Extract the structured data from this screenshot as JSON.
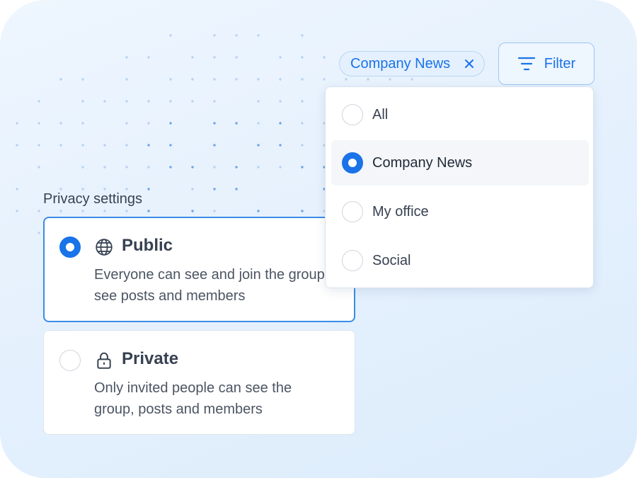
{
  "filter_bar": {
    "active_chip": {
      "label": "Company News",
      "remove_icon": "close-icon"
    },
    "filter_button": {
      "label": "Filter",
      "icon": "filter-lines-icon"
    }
  },
  "filter_dropdown": {
    "selected": "Company News",
    "items": [
      {
        "label": "All",
        "selected": false
      },
      {
        "label": "Company News",
        "selected": true
      },
      {
        "label": "My office",
        "selected": false
      },
      {
        "label": "Social",
        "selected": false
      }
    ]
  },
  "privacy": {
    "heading": "Privacy settings",
    "options": [
      {
        "title": "Public",
        "icon": "globe-icon",
        "description": "Everyone can see and join the group, see posts and members",
        "selected": true
      },
      {
        "title": "Private",
        "icon": "lock-icon",
        "description": "Only invited people can see the group, posts and members",
        "selected": false
      }
    ]
  },
  "colors": {
    "accent": "#1a73e8",
    "text": "#374151",
    "muted_text": "#4b5563",
    "background": "#e6f1fd"
  }
}
